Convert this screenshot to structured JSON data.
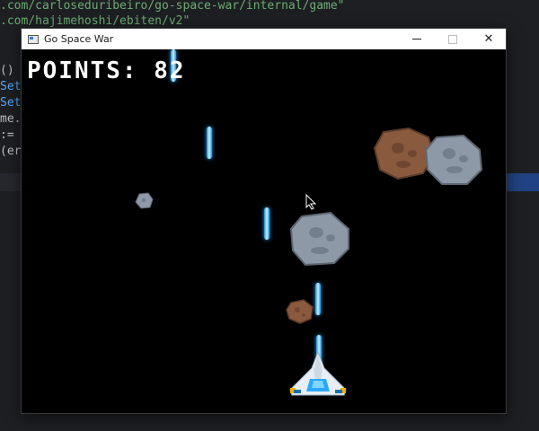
{
  "editor": {
    "lines": [
      {
        "prefix": "",
        "str": ".com/carloseduribeiro/go-space-war/internal/game\""
      },
      {
        "prefix": "",
        "str": ".com/hajimehoshi/ebiten/v2\""
      },
      {
        "prefix": "()",
        "str": ""
      },
      {
        "prefix": "Set",
        "str": ""
      },
      {
        "prefix": "Set",
        "str": ""
      },
      {
        "prefix": "me.",
        "str": ""
      },
      {
        "prefix": ":=",
        "str": ""
      },
      {
        "prefix": "(er",
        "str": ""
      }
    ]
  },
  "window": {
    "title": "Go Space War",
    "minimize_icon": "minimize-icon",
    "maximize_icon": "maximize-icon",
    "close_icon": "close-icon",
    "close_glyph": "✕"
  },
  "game": {
    "score_label": "POINTS: 82",
    "background_color": "#000000",
    "laser_color": "#2aa8ff",
    "ship_color": "#e8eef5",
    "meteor_gray_color": "#8d99a6",
    "meteor_brown_color": "#8a5a3f",
    "icons": [
      "laser",
      "meteor-gray",
      "meteor-brown",
      "player-ship",
      "mouse-cursor"
    ]
  }
}
